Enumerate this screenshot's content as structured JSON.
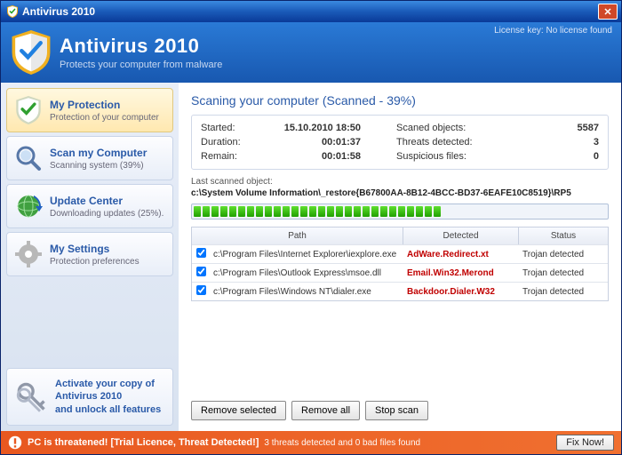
{
  "window": {
    "title": "Antivirus 2010"
  },
  "header": {
    "title": "Antivirus 2010",
    "subtitle": "Protects your computer from malware",
    "license_label": "License key:",
    "license_value": "No license found"
  },
  "sidebar": {
    "items": [
      {
        "title": "My Protection",
        "desc": "Protection of your computer"
      },
      {
        "title": "Scan my Computer",
        "desc": "Scanning system (39%)"
      },
      {
        "title": "Update Center",
        "desc": "Downloading updates (25%)."
      },
      {
        "title": "My Settings",
        "desc": "Protection preferences"
      }
    ],
    "activate": {
      "line1": "Activate your copy of",
      "line2": "Antivirus 2010",
      "line3": "and unlock all features"
    }
  },
  "scan": {
    "title": "Scaning your computer (Scanned - 39%)",
    "stats": {
      "started_label": "Started:",
      "started_value": "15.10.2010 18:50",
      "duration_label": "Duration:",
      "duration_value": "00:01:37",
      "remain_label": "Remain:",
      "remain_value": "00:01:58",
      "objects_label": "Scaned objects:",
      "objects_value": "5587",
      "threats_label": "Threats detected:",
      "threats_value": "3",
      "suspicious_label": "Suspicious files:",
      "suspicious_value": "0"
    },
    "last_label": "Last scanned object:",
    "last_path": "c:\\System Volume Information\\_restore{B67800AA-8B12-4BCC-BD37-6EAFE10C8519}\\RP5",
    "progress_segments": 28,
    "columns": {
      "path": "Path",
      "detected": "Detected",
      "status": "Status"
    },
    "rows": [
      {
        "path": "c:\\Program Files\\Internet Explorer\\iexplore.exe",
        "detected": "AdWare.Redirect.xt",
        "status": "Trojan detected"
      },
      {
        "path": "c:\\Program Files\\Outlook Express\\msoe.dll",
        "detected": "Email.Win32.Merond",
        "status": "Trojan detected"
      },
      {
        "path": "c:\\Program Files\\Windows NT\\dialer.exe",
        "detected": "Backdoor.Dialer.W32",
        "status": "Trojan detected"
      }
    ],
    "buttons": {
      "remove_selected": "Remove selected",
      "remove_all": "Remove all",
      "stop": "Stop scan"
    }
  },
  "status": {
    "message": "PC is threatened! [Trial Licence, Threat Detected!]",
    "detail": "3 threats detected and 0 bad files found",
    "fix": "Fix Now!"
  },
  "colors": {
    "accent": "#2a5aa8",
    "danger": "#c00000",
    "statusbar": "#e85820"
  }
}
